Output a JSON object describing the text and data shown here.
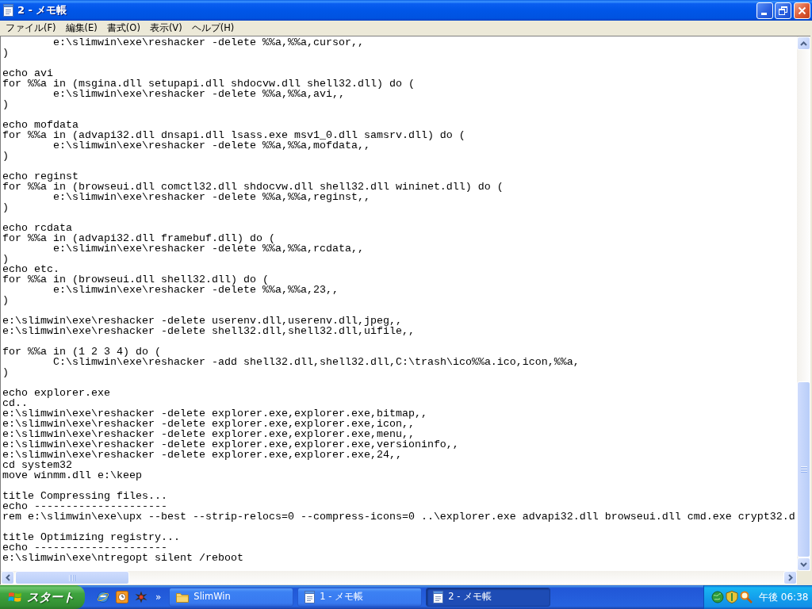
{
  "window": {
    "title": "2 - メモ帳"
  },
  "menu": [
    "ファイル(F)",
    "編集(E)",
    "書式(O)",
    "表示(V)",
    "ヘルプ(H)"
  ],
  "editor": {
    "paragraphs": [
      {
        "lines": [
          {
            "children": [
              {
                "text": "e:\\slimwin\\exe\\reshacker -delete %%a,%%a,cursor,,"
              }
            ]
          },
          {
            "text": ")"
          }
        ]
      },
      {
        "lines": [
          {
            "text": "echo avi"
          },
          {
            "text": "for %%a in (msgina.dll setupapi.dll shdocvw.dll shell32.dll) do (",
            "children": [
              {
                "text": "e:\\slimwin\\exe\\reshacker -delete %%a,%%a,avi,,"
              }
            ]
          },
          {
            "text": ")"
          }
        ]
      },
      {
        "lines": [
          {
            "text": "echo mofdata"
          },
          {
            "text": "for %%a in (advapi32.dll dnsapi.dll lsass.exe msv1_0.dll samsrv.dll) do (",
            "children": [
              {
                "text": "e:\\slimwin\\exe\\reshacker -delete %%a,%%a,mofdata,,"
              }
            ]
          },
          {
            "text": ")"
          }
        ]
      },
      {
        "lines": [
          {
            "text": "echo reginst"
          },
          {
            "text": "for %%a in (browseui.dll comctl32.dll shdocvw.dll shell32.dll wininet.dll) do (",
            "children": [
              {
                "text": "e:\\slimwin\\exe\\reshacker -delete %%a,%%a,reginst,,"
              }
            ]
          },
          {
            "text": ")"
          }
        ]
      },
      {
        "lines": [
          {
            "text": "echo rcdata"
          },
          {
            "text": "for %%a in (advapi32.dll framebuf.dll) do (",
            "children": [
              {
                "text": "e:\\slimwin\\exe\\reshacker -delete %%a,%%a,rcdata,,"
              }
            ]
          },
          {
            "text": ")"
          },
          {
            "text": "echo etc."
          },
          {
            "text": "for %%a in (browseui.dll shell32.dll) do (",
            "children": [
              {
                "text": "e:\\slimwin\\exe\\reshacker -delete %%a,%%a,23,,"
              }
            ]
          },
          {
            "text": ")"
          }
        ]
      },
      {
        "lines": [
          {
            "text": "e:\\slimwin\\exe\\reshacker -delete userenv.dll,userenv.dll,jpeg,,"
          },
          {
            "text": "e:\\slimwin\\exe\\reshacker -delete shell32.dll,shell32.dll,uifile,,"
          }
        ]
      },
      {
        "lines": [
          {
            "text": "for %%a in (1 2 3 4) do (",
            "children": [
              {
                "text": "C:\\slimwin\\exe\\reshacker -add shell32.dll,shell32.dll,C:\\trash\\ico%%a.ico,icon,%%a,"
              }
            ]
          },
          {
            "text": ")"
          }
        ]
      },
      {
        "lines": [
          {
            "text": "echo explorer.exe"
          },
          {
            "text": "cd.."
          },
          {
            "text": "e:\\slimwin\\exe\\reshacker -delete explorer.exe,explorer.exe,bitmap,,"
          },
          {
            "text": "e:\\slimwin\\exe\\reshacker -delete explorer.exe,explorer.exe,icon,,"
          },
          {
            "text": "e:\\slimwin\\exe\\reshacker -delete explorer.exe,explorer.exe,menu,,"
          },
          {
            "text": "e:\\slimwin\\exe\\reshacker -delete explorer.exe,explorer.exe,versioninfo,,"
          },
          {
            "text": "e:\\slimwin\\exe\\reshacker -delete explorer.exe,explorer.exe,24,,"
          },
          {
            "text": "cd system32"
          },
          {
            "text": "move winmm.dll e:\\keep"
          }
        ]
      },
      {
        "lines": [
          {
            "text": "title Compressing files..."
          },
          {
            "text": "echo ---------------------"
          },
          {
            "text": "rem e:\\slimwin\\exe\\upx --best --strip-relocs=0 --compress-icons=0 ..\\explorer.exe advapi32.dll browseui.dll cmd.exe crypt32.d"
          }
        ]
      },
      {
        "lines": [
          {
            "text": "title Optimizing registry..."
          },
          {
            "text": "echo ---------------------"
          },
          {
            "text": "e:\\slimwin\\exe\\ntregopt silent /reboot"
          }
        ]
      }
    ]
  },
  "taskbar": {
    "start": "スタート",
    "quick_launch_more": "»",
    "tasks": [
      {
        "kind": "folder",
        "label": "SlimWin",
        "selected": false
      },
      {
        "kind": "notepad",
        "label": "1 - メモ帳",
        "selected": false
      },
      {
        "kind": "notepad",
        "label": "2 - メモ帳",
        "selected": true
      }
    ],
    "clock": "午後 06:38"
  }
}
